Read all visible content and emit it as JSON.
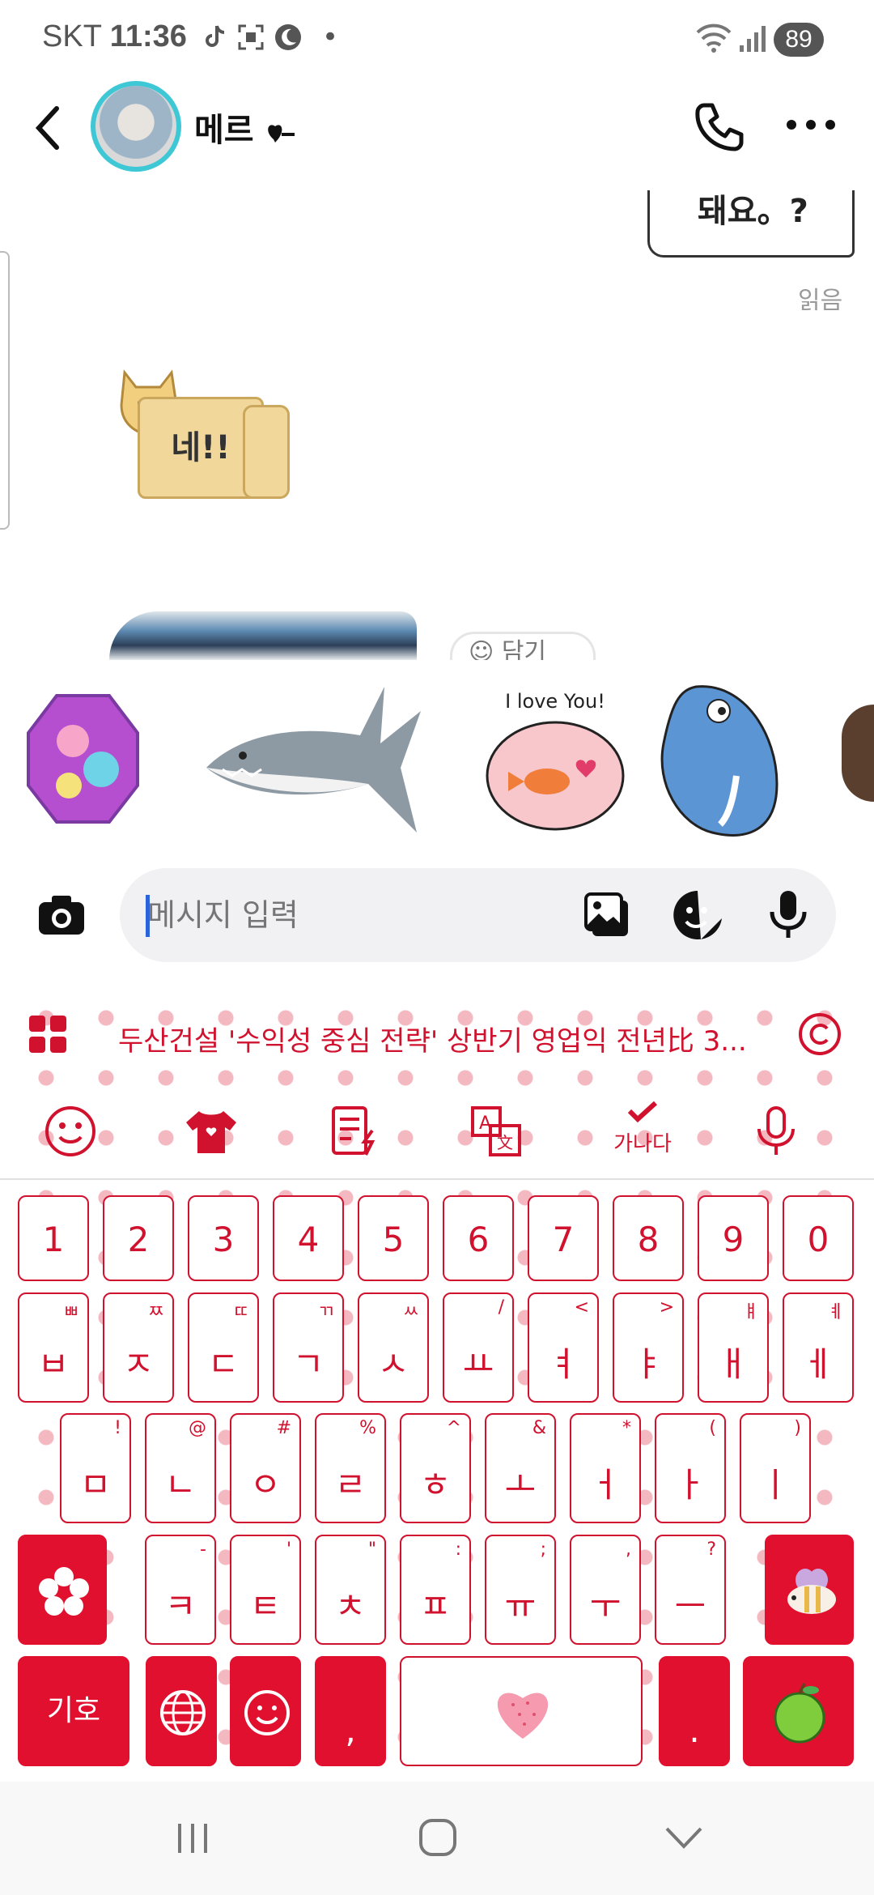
{
  "status_bar": {
    "carrier": "SKT",
    "time": "11:36",
    "battery": "89",
    "dot": "•"
  },
  "header": {
    "contact_name": "메르",
    "back_icon": "back-arrow-icon",
    "call_icon": "phone-icon",
    "more_icon": "more-dots-icon"
  },
  "chat": {
    "top_sticker_text": "돼요。?",
    "read_label": "읽음",
    "doge_sticker_text": "네!!",
    "partial_button": "담기"
  },
  "sticker_suggestions": [
    {
      "name": "sticker-crystal"
    },
    {
      "name": "sticker-shark"
    },
    {
      "name": "sticker-fishbowl",
      "text": "I love You!"
    },
    {
      "name": "sticker-blue-fish"
    },
    {
      "name": "sticker-face-partial"
    }
  ],
  "input": {
    "placeholder": "메시지 입력"
  },
  "keyboard": {
    "news_text": "두산건설 '수익성 중심 전략' 상반기 영업익 전년比 3...",
    "toolbar": {
      "check_label": "가나다"
    },
    "row_numbers": [
      "1",
      "2",
      "3",
      "4",
      "5",
      "6",
      "7",
      "8",
      "9",
      "0"
    ],
    "row1": [
      {
        "main": "ㅂ",
        "sub": "ㅃ"
      },
      {
        "main": "ㅈ",
        "sub": "ㅉ"
      },
      {
        "main": "ㄷ",
        "sub": "ㄸ"
      },
      {
        "main": "ㄱ",
        "sub": "ㄲ"
      },
      {
        "main": "ㅅ",
        "sub": "ㅆ"
      },
      {
        "main": "ㅛ",
        "sub": "/"
      },
      {
        "main": "ㅕ",
        "sub": "<"
      },
      {
        "main": "ㅑ",
        "sub": ">"
      },
      {
        "main": "ㅐ",
        "sub": "ㅒ"
      },
      {
        "main": "ㅔ",
        "sub": "ㅖ"
      }
    ],
    "row2": [
      {
        "main": "ㅁ",
        "sub": "!"
      },
      {
        "main": "ㄴ",
        "sub": "@"
      },
      {
        "main": "ㅇ",
        "sub": "#"
      },
      {
        "main": "ㄹ",
        "sub": "%"
      },
      {
        "main": "ㅎ",
        "sub": "^"
      },
      {
        "main": "ㅗ",
        "sub": "&"
      },
      {
        "main": "ㅓ",
        "sub": "*"
      },
      {
        "main": "ㅏ",
        "sub": "("
      },
      {
        "main": "ㅣ",
        "sub": ")"
      }
    ],
    "row3": [
      {
        "main": "ㅋ",
        "sub": "-"
      },
      {
        "main": "ㅌ",
        "sub": "'"
      },
      {
        "main": "ㅊ",
        "sub": "\""
      },
      {
        "main": "ㅍ",
        "sub": ":"
      },
      {
        "main": "ㅠ",
        "sub": ";"
      },
      {
        "main": "ㅜ",
        "sub": ","
      },
      {
        "main": "ㅡ",
        "sub": "?"
      }
    ],
    "bottom": {
      "symbol_label": "기호",
      "comma": ",",
      "period": "."
    }
  },
  "colors": {
    "accent": "#e0102e",
    "key_text": "#d1122e",
    "avatar_ring": "#3ec8d6"
  }
}
